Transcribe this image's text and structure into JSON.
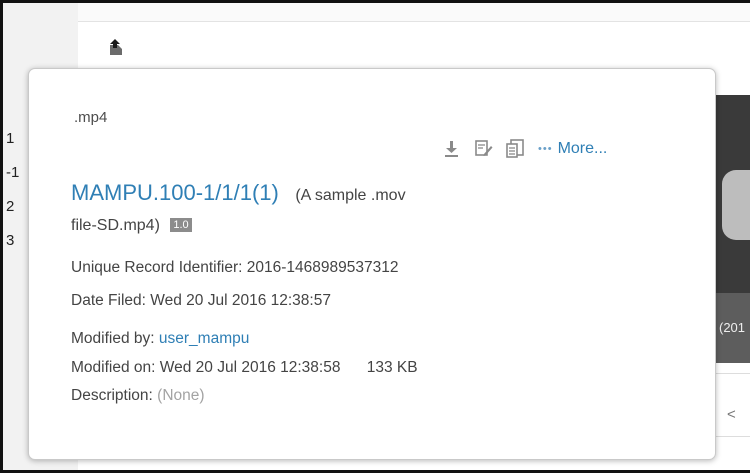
{
  "background": {
    "row_numbers": [
      "1",
      "-1",
      "2",
      "3"
    ],
    "thumb_caption": "(201"
  },
  "popup": {
    "extension": ".mp4",
    "actions": {
      "more_label": "More..."
    },
    "title": "MAMPU.100-1/1/1(1)",
    "original_name_part1": "(A sample .mov",
    "original_name_part2": "file-SD.mp4)",
    "version": "1.0",
    "uri_label": "Unique Record Identifier:",
    "uri_value": "2016-1468989537312",
    "date_filed_label": "Date Filed:",
    "date_filed_value": "Wed 20 Jul 2016 12:38:57",
    "modified_by_label": "Modified by:",
    "modified_by_value": "user_mampu",
    "modified_on_label": "Modified on:",
    "modified_on_value": "Wed 20 Jul 2016 12:38:58",
    "size": "133 KB",
    "description_label": "Description:",
    "description_value": "(None)"
  },
  "colors": {
    "link": "#2f7fb5",
    "muted": "#a3a3a3",
    "version_badge": "#8c8c8c"
  }
}
